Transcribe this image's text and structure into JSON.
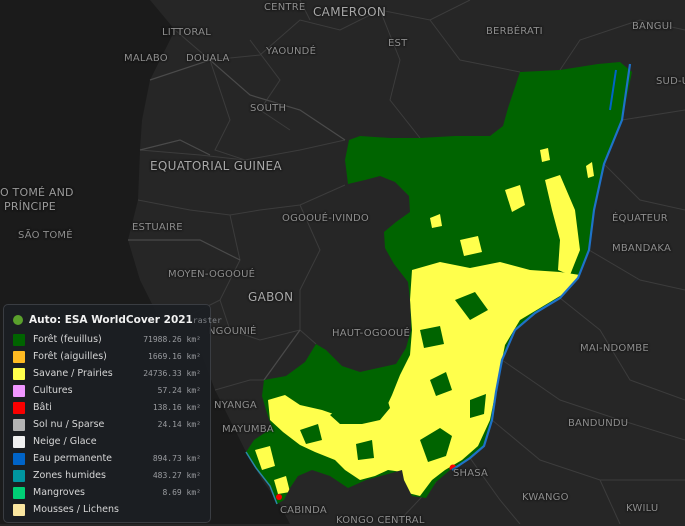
{
  "map": {
    "labels": [
      {
        "id": "centre",
        "text": "CENTRE"
      },
      {
        "id": "cameroon",
        "text": "CAMEROON"
      },
      {
        "id": "bangui",
        "text": "BANGUI"
      },
      {
        "id": "littoral",
        "text": "LITTORAL"
      },
      {
        "id": "yaounde",
        "text": "YAOUNDÉ"
      },
      {
        "id": "est",
        "text": "EST"
      },
      {
        "id": "berberati",
        "text": "BERBÉRATI"
      },
      {
        "id": "sud-u",
        "text": "SUD-U"
      },
      {
        "id": "malabo",
        "text": "MALABO"
      },
      {
        "id": "douala",
        "text": "DOUALA"
      },
      {
        "id": "south",
        "text": "SOUTH"
      },
      {
        "id": "eq-guinea",
        "text": "EQUATORIAL GUINEA"
      },
      {
        "id": "sao-tome",
        "text": "O TOMÉ AND"
      },
      {
        "id": "principe",
        "text": "PRÍNCIPE"
      },
      {
        "id": "sao-tome-city",
        "text": "SÃO TOMÉ"
      },
      {
        "id": "estuaire",
        "text": "ESTUAIRE"
      },
      {
        "id": "ogooue-ivindo",
        "text": "OGOOUÉ-IVINDO"
      },
      {
        "id": "equateur",
        "text": "ÉQUATEUR"
      },
      {
        "id": "mbandaka",
        "text": "MBANDAKA"
      },
      {
        "id": "moyen-ogooue",
        "text": "MOYEN-OGOOUÉ"
      },
      {
        "id": "gabon",
        "text": "GABON"
      },
      {
        "id": "ngounie",
        "text": "NGOUNIÉ"
      },
      {
        "id": "haut-ogooue",
        "text": "HAUT-OGOOUÉ"
      },
      {
        "id": "mai-ndombe",
        "text": "MAI-NDOMBE"
      },
      {
        "id": "nyanga",
        "text": "NYANGA"
      },
      {
        "id": "bandundu",
        "text": "BANDUNDU"
      },
      {
        "id": "mayumba",
        "text": "MAYUMBA"
      },
      {
        "id": "kinshasa",
        "text": "SHASA"
      },
      {
        "id": "kwango",
        "text": "KWANGO"
      },
      {
        "id": "cabinda",
        "text": "CABINDA"
      },
      {
        "id": "kwilu",
        "text": "KWILU"
      },
      {
        "id": "kongo-central",
        "text": "KONGO CENTRAL"
      }
    ]
  },
  "legend": {
    "title": "Auto: ESA WorldCover 2021",
    "type": "raster",
    "dot_color": "#5aa02c",
    "items": [
      {
        "label": "Forêt (feuillus)",
        "area": "71988.26 km²",
        "color": "#006400"
      },
      {
        "label": "Forêt (aiguilles)",
        "area": "1669.16 km²",
        "color": "#ffbb22"
      },
      {
        "label": "Savane / Prairies",
        "area": "24736.33 km²",
        "color": "#ffff4c"
      },
      {
        "label": "Cultures",
        "area": "57.24 km²",
        "color": "#f096ff"
      },
      {
        "label": "Bâti",
        "area": "138.16 km²",
        "color": "#fa0000"
      },
      {
        "label": "Sol nu / Sparse",
        "area": "24.14 km²",
        "color": "#b4b4b4"
      },
      {
        "label": "Neige / Glace",
        "area": "",
        "color": "#f0f0f0"
      },
      {
        "label": "Eau permanente",
        "area": "894.73 km²",
        "color": "#0064c8"
      },
      {
        "label": "Zones humides",
        "area": "483.27 km²",
        "color": "#0096a0"
      },
      {
        "label": "Mangroves",
        "area": "8.69 km²",
        "color": "#00cf75"
      },
      {
        "label": "Mousses / Lichens",
        "area": "",
        "color": "#fae6a0"
      }
    ]
  }
}
